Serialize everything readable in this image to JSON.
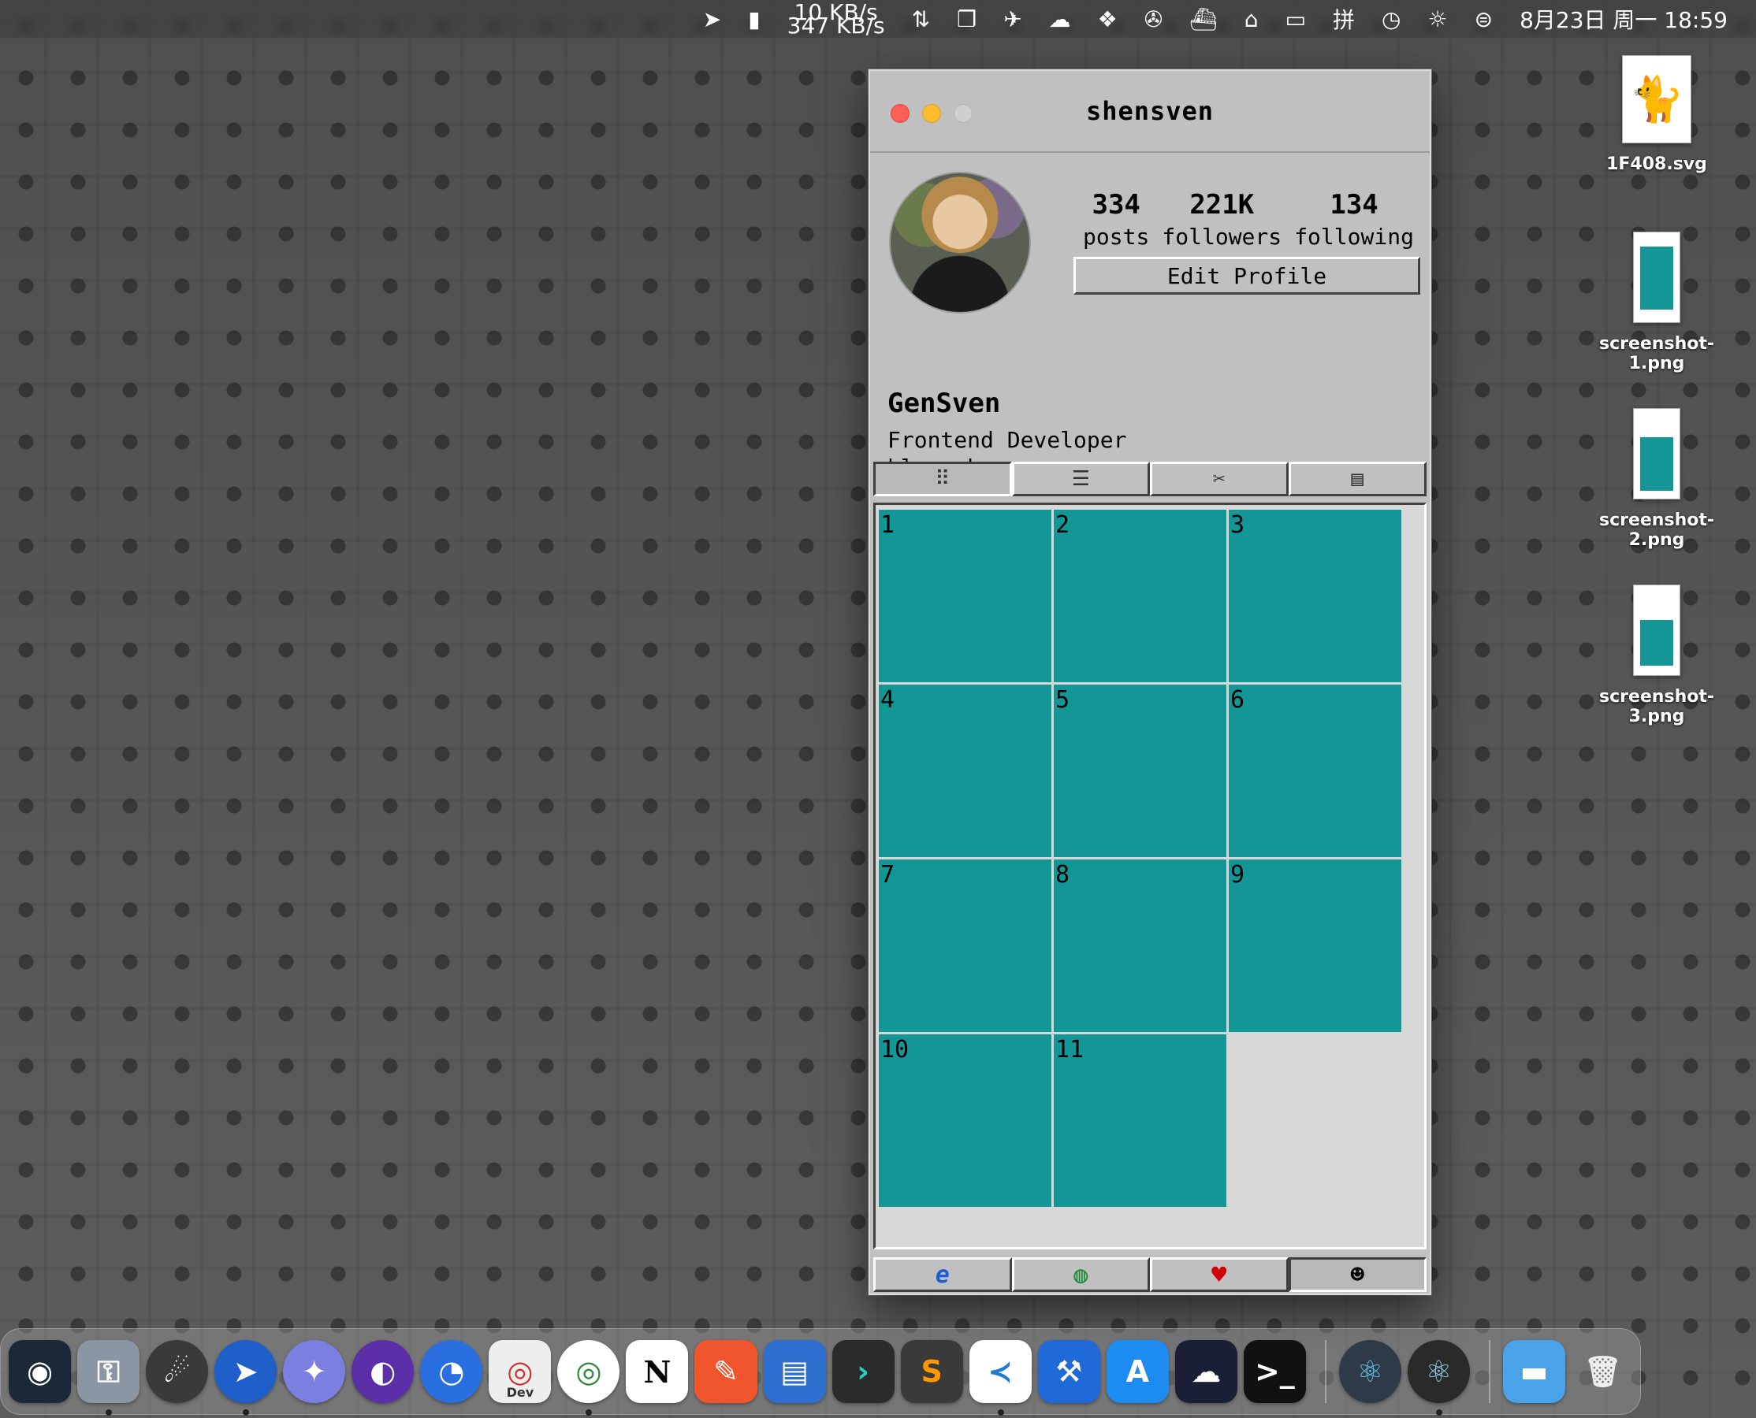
{
  "menubar": {
    "net_up": "10 KB/s",
    "net_down": "347 KB/s",
    "ime": "拼",
    "clock": "8月23日 周一  18:59"
  },
  "desktop": {
    "items": [
      {
        "label": "1F408.svg"
      },
      {
        "label": "screenshot-1.png"
      },
      {
        "label": "screenshot-2.png"
      },
      {
        "label": "screenshot-3.png"
      }
    ]
  },
  "window": {
    "title": "shensven",
    "stats": [
      {
        "value": "334",
        "label": "posts"
      },
      {
        "value": "221K",
        "label": "followers"
      },
      {
        "value": "134",
        "label": "following"
      }
    ],
    "edit_button": "Edit Profile",
    "bio": {
      "name": "GenSven",
      "line1": "Frontend Developer",
      "line2": "blog.shensven.com"
    },
    "tabs": [
      {
        "icon": "grid-icon",
        "glyph": "⠿"
      },
      {
        "icon": "list-icon",
        "glyph": "☰"
      },
      {
        "icon": "tools-icon",
        "glyph": "✂"
      },
      {
        "icon": "folder-icon",
        "glyph": "▤"
      }
    ],
    "posts": [
      "1",
      "2",
      "3",
      "4",
      "5",
      "6",
      "7",
      "8",
      "9",
      "10",
      "11"
    ],
    "bottom_nav": [
      {
        "icon": "internet-explorer-icon",
        "glyph": "e",
        "color": "#1a5fd1"
      },
      {
        "icon": "globe-icon",
        "glyph": "◍",
        "color": "#1e8a3a"
      },
      {
        "icon": "heart-icon",
        "glyph": "♥",
        "color": "#d00000"
      },
      {
        "icon": "profile-icon",
        "glyph": "☻",
        "color": "#000000"
      }
    ]
  },
  "dock": {
    "dev_label": "Dev"
  }
}
